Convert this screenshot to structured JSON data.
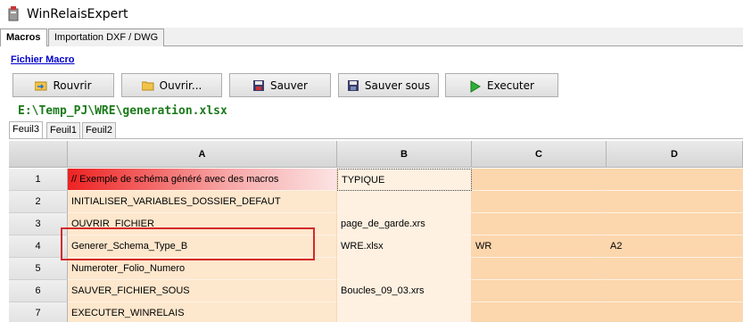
{
  "app": {
    "title": "WinRelaisExpert"
  },
  "top_tabs": [
    {
      "label": "Macros"
    },
    {
      "label": "Importation DXF / DWG"
    }
  ],
  "panel": {
    "section_title": "Fichier Macro",
    "buttons": {
      "reopen": "Rouvrir",
      "open": "Ouvrir...",
      "save": "Sauver",
      "save_as": "Sauver sous",
      "execute": "Executer"
    },
    "file_path": "E:\\Temp_PJ\\WRE\\generation.xlsx"
  },
  "sheet_tabs": [
    {
      "label": "Feuil3"
    },
    {
      "label": "Feuil1"
    },
    {
      "label": "Feuil2"
    }
  ],
  "grid": {
    "columns": [
      "A",
      "B",
      "C",
      "D"
    ],
    "rows": [
      {
        "num": "1",
        "a": "// Exemple de schéma généré avec des macros",
        "b": "TYPIQUE",
        "c": "",
        "d": ""
      },
      {
        "num": "2",
        "a": "INITIALISER_VARIABLES_DOSSIER_DEFAUT",
        "b": "",
        "c": "",
        "d": ""
      },
      {
        "num": "3",
        "a": "OUVRIR_FICHIER",
        "b": "page_de_garde.xrs",
        "c": "",
        "d": ""
      },
      {
        "num": "4",
        "a": "Generer_Schema_Type_B",
        "b": "WRE.xlsx",
        "c": "WR",
        "d": "A2"
      },
      {
        "num": "5",
        "a": "Numeroter_Folio_Numero",
        "b": "",
        "c": "",
        "d": ""
      },
      {
        "num": "6",
        "a": "SAUVER_FICHIER_SOUS",
        "b": "Boucles_09_03.xrs",
        "c": "",
        "d": ""
      },
      {
        "num": "7",
        "a": "EXECUTER_WINRELAIS",
        "b": "",
        "c": "",
        "d": ""
      }
    ]
  },
  "colors": {
    "highlight_border": "#d42a2a",
    "path_green": "#1a7a1a",
    "link_blue": "#0000cc"
  }
}
